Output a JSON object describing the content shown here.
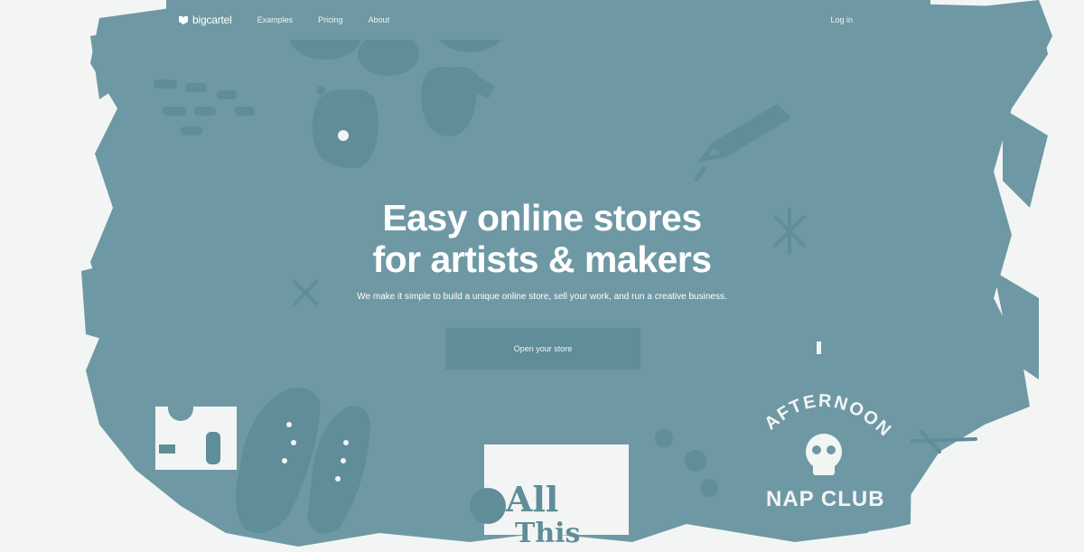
{
  "nav": {
    "brand": "bigcartel",
    "links": [
      "Examples",
      "Pricing",
      "About"
    ],
    "login": "Log in"
  },
  "hero": {
    "title_line1": "Easy online stores",
    "title_line2": "for artists & makers",
    "subtitle": "We make it simple to build a unique online store, sell your work, and run a creative business.",
    "cta_label": "Open your store"
  },
  "illustrations": {
    "tshirt_top": "AFTERNOON",
    "tshirt_bottom": "NAP CLUB",
    "poster_line1": "All",
    "poster_line2": "This"
  },
  "colors": {
    "paint": "#6e99a4",
    "background": "#f3f5f5",
    "text": "#ffffff",
    "button": "#5f8d98"
  },
  "icons": [
    "bigcartel-logo-icon",
    "mitten-icon",
    "pencil-icon",
    "sparkle-icon",
    "sneakers-icon",
    "tshirt-icon",
    "skull-icon",
    "poster-icon"
  ]
}
